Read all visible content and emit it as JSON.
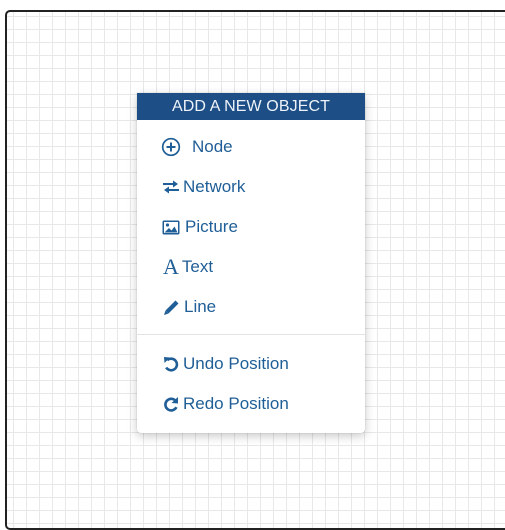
{
  "menu": {
    "header": "ADD A NEW OBJECT",
    "items": [
      {
        "label": "Node",
        "icon": "plus-circle-icon"
      },
      {
        "label": "Network",
        "icon": "exchange-icon"
      },
      {
        "label": "Picture",
        "icon": "picture-icon"
      },
      {
        "label": "Text",
        "icon": "text-icon"
      },
      {
        "label": "Line",
        "icon": "pencil-icon"
      }
    ],
    "history": [
      {
        "label": "Undo Position",
        "icon": "undo-icon"
      },
      {
        "label": "Redo Position",
        "icon": "redo-icon"
      }
    ]
  },
  "colors": {
    "header_bg": "#1d4f86",
    "item_text": "#1f5e96",
    "grid_line": "#e8e8e8"
  }
}
